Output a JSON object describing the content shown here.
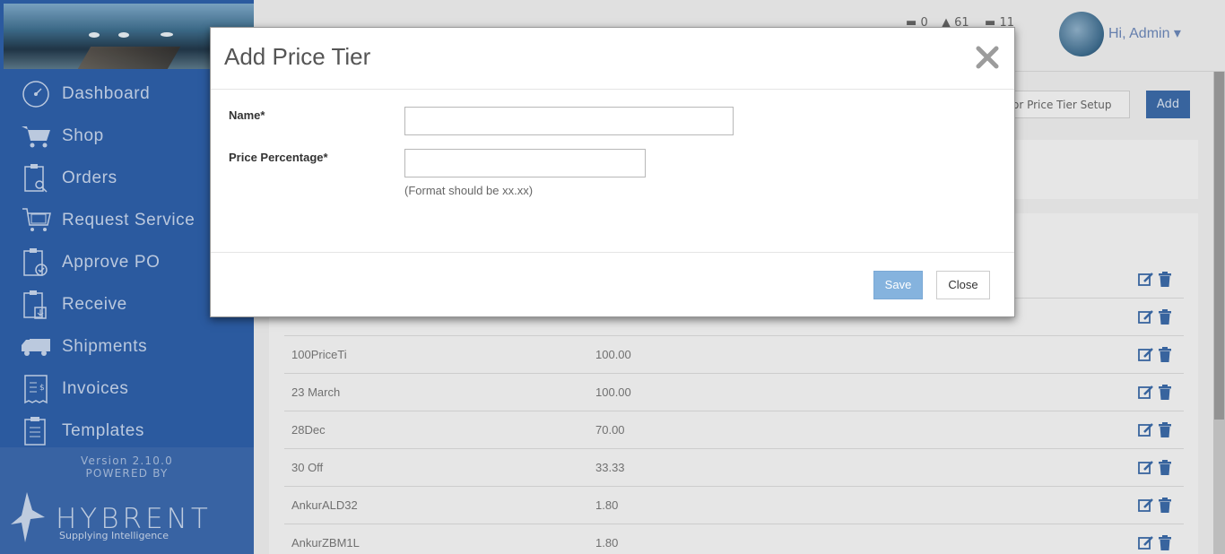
{
  "colors": {
    "sidebar_bg": "#2e5fa8",
    "primary": "#3b6aa7",
    "save_button": "#85b3de",
    "icon_action": "#3b6aa7"
  },
  "sidebar": {
    "items": [
      {
        "label": "Dashboard",
        "icon": "dashboard-icon"
      },
      {
        "label": "Shop",
        "icon": "cart-icon"
      },
      {
        "label": "Orders",
        "icon": "orders-icon"
      },
      {
        "label": "Request Service",
        "icon": "request-service-icon"
      },
      {
        "label": "Approve PO",
        "icon": "approve-po-icon"
      },
      {
        "label": "Receive",
        "icon": "receive-icon"
      },
      {
        "label": "Shipments",
        "icon": "truck-icon"
      },
      {
        "label": "Invoices",
        "icon": "invoice-icon"
      },
      {
        "label": "Templates",
        "icon": "templates-icon"
      }
    ],
    "version": "Version 2.10.0",
    "powered_by": "POWERED BY",
    "brand": "HYBRENT",
    "tagline": "Supplying Intelligence"
  },
  "header": {
    "notif_counts": [
      "0",
      "61",
      "11"
    ],
    "greeting": "Hi, Admin"
  },
  "toolbar": {
    "setup_label": "or Price Tier Setup",
    "add_label": "Add"
  },
  "table": {
    "rows": [
      {
        "name": "",
        "value": ""
      },
      {
        "name": "",
        "value": ""
      },
      {
        "name": "100PriceTi",
        "value": "100.00"
      },
      {
        "name": "23 March",
        "value": "100.00"
      },
      {
        "name": "28Dec",
        "value": "70.00"
      },
      {
        "name": "30 Off",
        "value": "33.33"
      },
      {
        "name": "AnkurALD32",
        "value": "1.80"
      },
      {
        "name": "AnkurZBM1L",
        "value": "1.80"
      }
    ]
  },
  "modal": {
    "title": "Add Price Tier",
    "name_label": "Name*",
    "name_value": "",
    "percentage_label": "Price Percentage*",
    "percentage_value": "",
    "help_text": "(Format should be xx.xx)",
    "save_label": "Save",
    "close_label": "Close"
  }
}
